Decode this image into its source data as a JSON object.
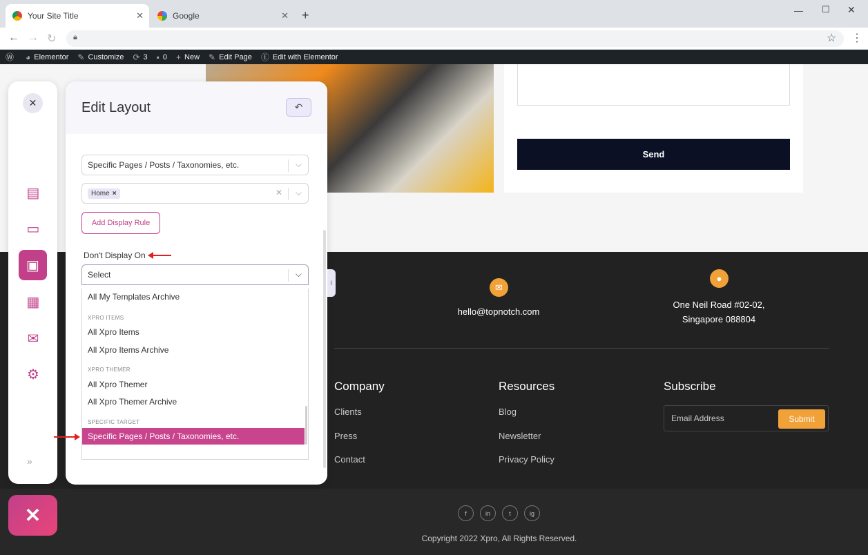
{
  "browser": {
    "tabs": [
      {
        "label": "Your Site Title",
        "active": true
      },
      {
        "label": "Google",
        "active": false
      }
    ],
    "new_tab": "+"
  },
  "wp_admin_bar": {
    "items": [
      {
        "label": "Elementor",
        "icon": "dashboard-icon"
      },
      {
        "label": "Customize",
        "icon": "brush-icon"
      },
      {
        "label": "3",
        "icon": "updates-icon"
      },
      {
        "label": "0",
        "icon": "comment-icon"
      },
      {
        "label": "New",
        "icon": "plus-icon"
      },
      {
        "label": "Edit Page",
        "icon": "pencil-icon"
      },
      {
        "label": "Edit with Elementor",
        "icon": "elementor-icon"
      }
    ]
  },
  "contact_form": {
    "send_label": "Send"
  },
  "footer": {
    "email": "hello@topnotch.com",
    "address_line1": "One Neil Road #02-02,",
    "address_line2": "Singapore 088804",
    "company": {
      "heading": "Company",
      "links": [
        "Clients",
        "Press",
        "Contact"
      ]
    },
    "resources": {
      "heading": "Resources",
      "links": [
        "Blog",
        "Newsletter",
        "Privacy Policy"
      ]
    },
    "subscribe": {
      "heading": "Subscribe",
      "placeholder": "Email Address",
      "button": "Submit"
    },
    "social": [
      "f",
      "in",
      "t",
      "ig"
    ],
    "copyright": "Copyright 2022 Xpro, All Rights Reserved."
  },
  "panel": {
    "title": "Edit Layout",
    "display_on_value": "Specific Pages / Posts / Taxonomies, etc.",
    "display_on_tag": "Home",
    "add_rule_label": "Add Display Rule",
    "dont_display_label": "Don't Display On",
    "dont_display_placeholder": "Select",
    "dropdown": {
      "opt_templates_archive": "All My Templates Archive",
      "group_xpro_items": "XPRO ITEMS",
      "opt_xpro_items": "All Xpro Items",
      "opt_xpro_items_archive": "All Xpro Items Archive",
      "group_xpro_themer": "XPRO THEMER",
      "opt_xpro_themer": "All Xpro Themer",
      "opt_xpro_themer_archive": "All Xpro Themer Archive",
      "group_specific_target": "SPECIFIC TARGET",
      "opt_specific": "Specific Pages / Posts / Taxonomies, etc."
    }
  },
  "colors": {
    "accent": "#c2408a",
    "footer_accent": "#f0a138",
    "footer_bg": "#222222"
  }
}
